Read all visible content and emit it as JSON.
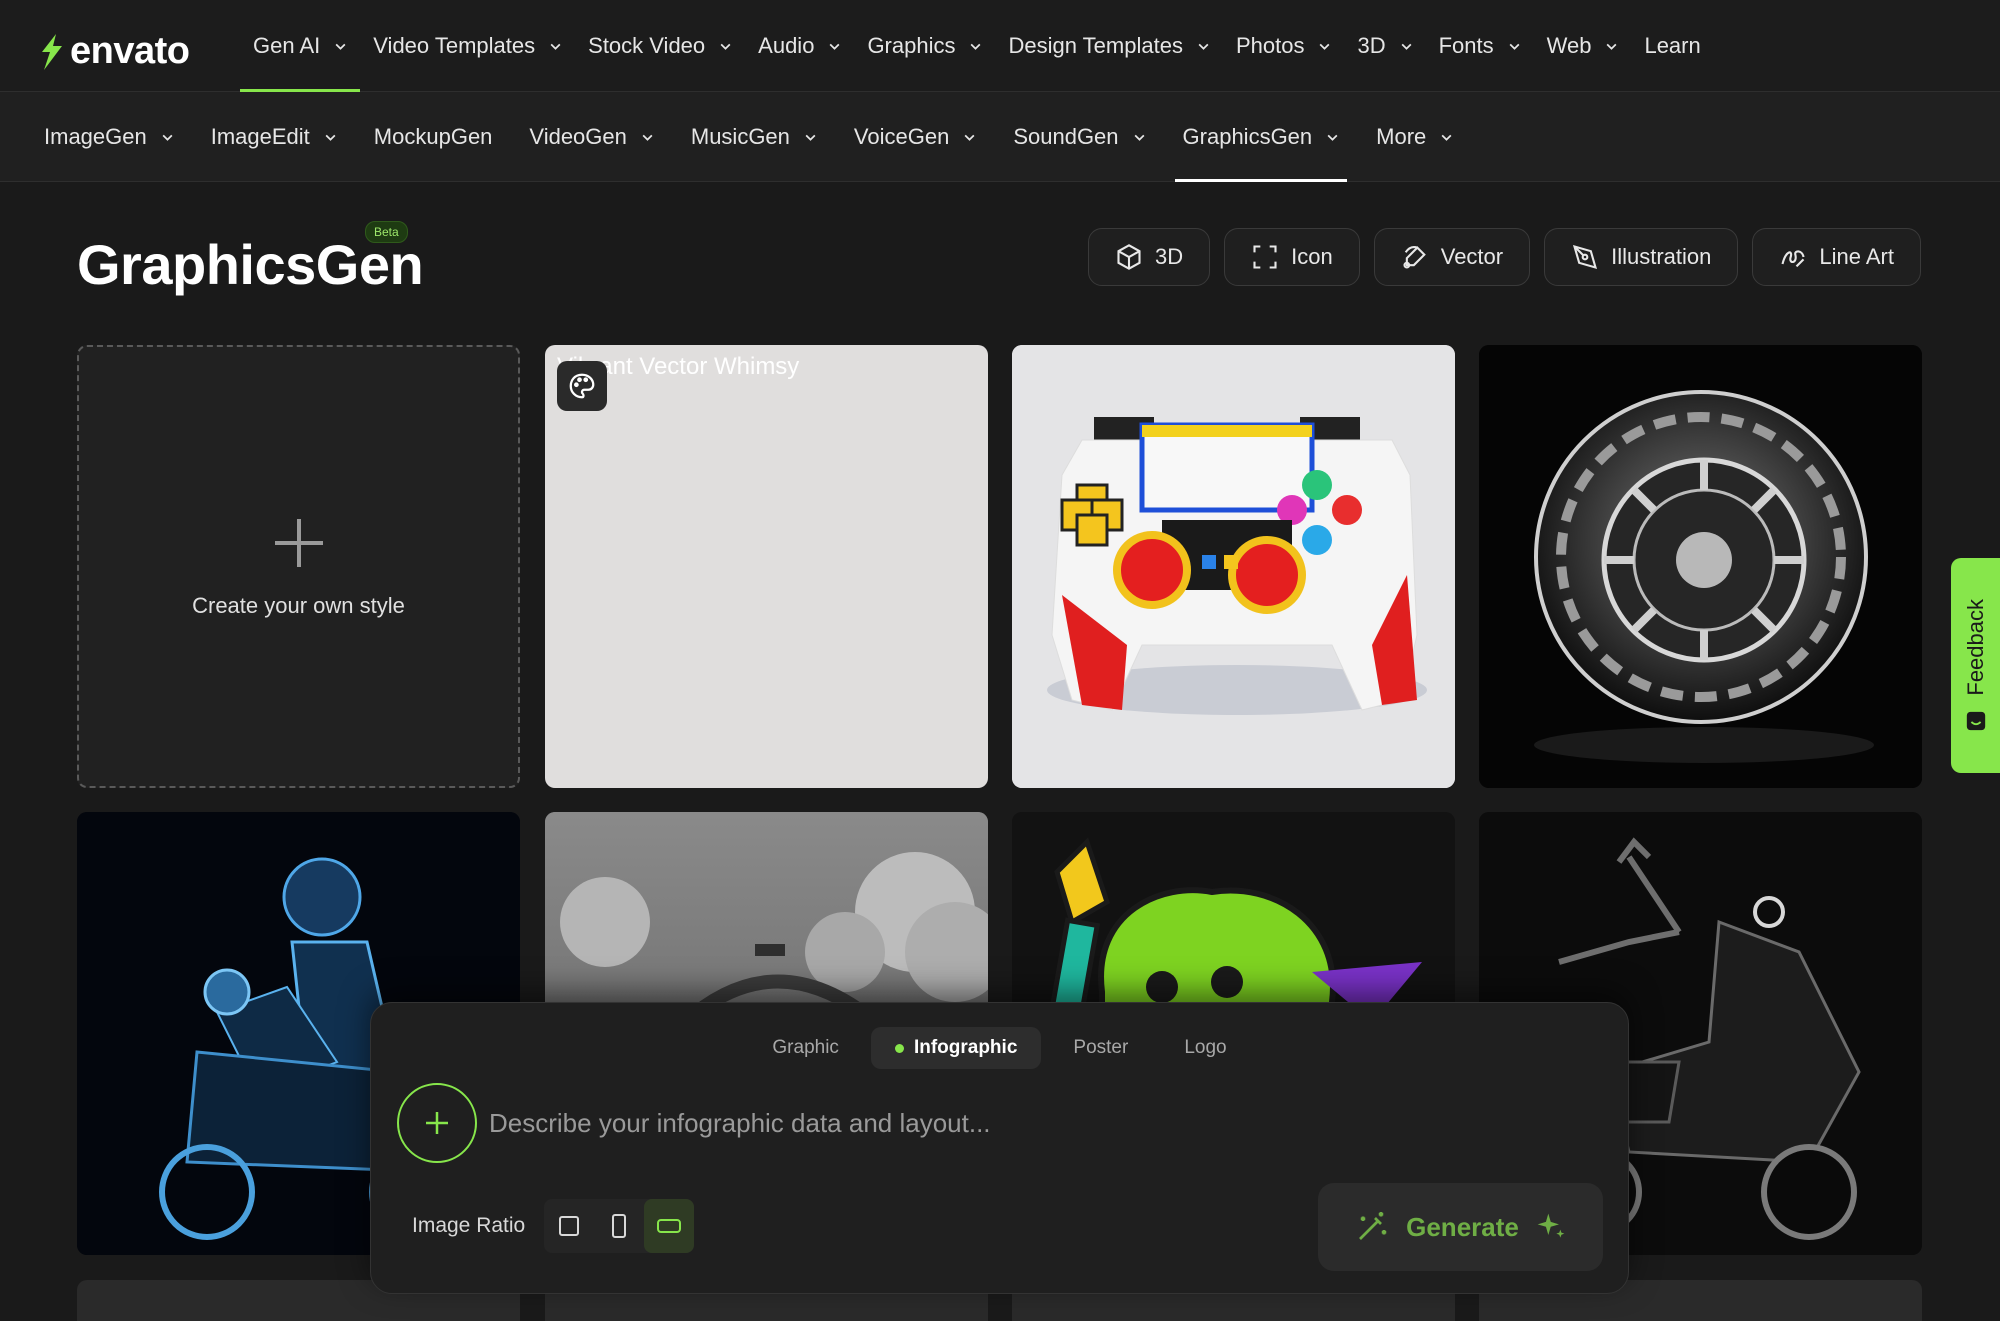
{
  "brand": {
    "name": "envato",
    "accent": "#87e64b"
  },
  "topnav": {
    "items": [
      {
        "label": "Gen AI",
        "dropdown": true
      },
      {
        "label": "Video Templates",
        "dropdown": true
      },
      {
        "label": "Stock Video",
        "dropdown": true
      },
      {
        "label": "Audio",
        "dropdown": true
      },
      {
        "label": "Graphics",
        "dropdown": true
      },
      {
        "label": "Design Templates",
        "dropdown": true
      },
      {
        "label": "Photos",
        "dropdown": true
      },
      {
        "label": "3D",
        "dropdown": true
      },
      {
        "label": "Fonts",
        "dropdown": true
      },
      {
        "label": "Web",
        "dropdown": true
      },
      {
        "label": "Learn",
        "dropdown": false
      }
    ]
  },
  "subnav": {
    "items": [
      {
        "label": "ImageGen",
        "dropdown": true
      },
      {
        "label": "ImageEdit",
        "dropdown": true
      },
      {
        "label": "MockupGen",
        "dropdown": false
      },
      {
        "label": "VideoGen",
        "dropdown": true
      },
      {
        "label": "MusicGen",
        "dropdown": true
      },
      {
        "label": "VoiceGen",
        "dropdown": true
      },
      {
        "label": "SoundGen",
        "dropdown": true
      },
      {
        "label": "GraphicsGen",
        "dropdown": true
      },
      {
        "label": "More",
        "dropdown": true
      }
    ]
  },
  "header": {
    "title": "GraphicsGen",
    "badge": "Beta"
  },
  "style_chips": [
    {
      "label": "3D",
      "icon": "cube-icon"
    },
    {
      "label": "Icon",
      "icon": "frame-icon"
    },
    {
      "label": "Vector",
      "icon": "vector-pen-icon"
    },
    {
      "label": "Illustration",
      "icon": "pen-nib-icon"
    },
    {
      "label": "Line Art",
      "icon": "line-art-icon"
    }
  ],
  "grid": {
    "create_label": "Create your own style",
    "broken_image_alt": "Vibrant Vector Whimsy"
  },
  "feedback": {
    "label": "Feedback"
  },
  "prompt": {
    "tabs": [
      {
        "label": "Graphic"
      },
      {
        "label": "Infographic"
      },
      {
        "label": "Poster"
      },
      {
        "label": "Logo"
      }
    ],
    "placeholder": "Describe your infographic data and layout...",
    "ratio_label": "Image Ratio",
    "ratios": [
      "square",
      "portrait",
      "landscape"
    ],
    "selected_ratio": "landscape",
    "generate_label": "Generate"
  }
}
